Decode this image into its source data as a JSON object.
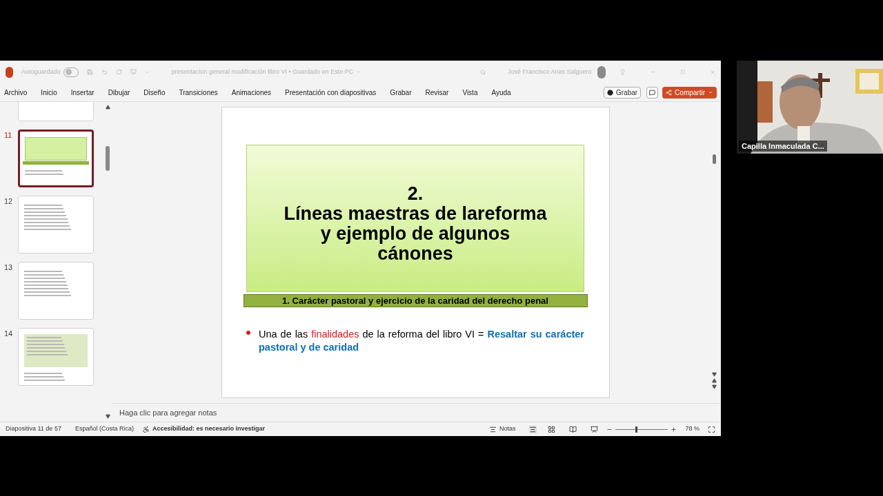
{
  "title_bar": {
    "autosave_label": "Autoguardado",
    "autosave_on": false,
    "document_title": "presentacion general modificación libro VI • Guardado en Este PC",
    "user_name": "José Francisco Arias Salguero"
  },
  "ribbon_tabs": [
    {
      "label": "Archivo",
      "selected": false
    },
    {
      "label": "Inicio",
      "selected": false
    },
    {
      "label": "Insertar",
      "selected": false
    },
    {
      "label": "Dibujar",
      "selected": false
    },
    {
      "label": "Diseño",
      "selected": false
    },
    {
      "label": "Transiciones",
      "selected": false
    },
    {
      "label": "Animaciones",
      "selected": false
    },
    {
      "label": "Presentación con diapositivas",
      "selected": false
    },
    {
      "label": "Grabar",
      "selected": false
    },
    {
      "label": "Revisar",
      "selected": false
    },
    {
      "label": "Vista",
      "selected": false
    },
    {
      "label": "Ayuda",
      "selected": false
    }
  ],
  "ribbon_buttons": {
    "record": "Grabar",
    "share": "Compartir"
  },
  "thumbnails": [
    {
      "selected": false,
      "kind": "text"
    },
    {
      "number": "11",
      "selected": true,
      "kind": "title"
    },
    {
      "number": "12",
      "selected": false,
      "kind": "text"
    },
    {
      "number": "13",
      "selected": false,
      "kind": "text"
    },
    {
      "number": "14",
      "selected": false,
      "kind": "boxed"
    }
  ],
  "slide": {
    "title_lines": [
      "2.",
      "Líneas maestras de lareforma",
      "y ejemplo de algunos",
      "cánones"
    ],
    "subtitle": "1. Carácter pastoral y ejercicio de la caridad del derecho penal",
    "bullet": [
      {
        "text": "Una de las ",
        "kind": "normal"
      },
      {
        "text": "finalidades",
        "kind": "highlight"
      },
      {
        "text": " de la reforma del libro VI = ",
        "kind": "normal"
      },
      {
        "text": "Resaltar su carácter pastoral y de caridad",
        "kind": "emphasis"
      }
    ]
  },
  "notes_placeholder": "Haga clic para agregar notas",
  "status_bar": {
    "slide_counter": "Diapositiva 11 de 57",
    "language": "Español (Costa Rica)",
    "accessibility": "Accesibilidad: es necesario investigar",
    "notes": "Notas",
    "zoom": "78 %",
    "zoom_slider": {
      "level": 0.38
    }
  },
  "video_tile": {
    "kind": "picture",
    "name": "Capilla Inmaculada C..."
  }
}
